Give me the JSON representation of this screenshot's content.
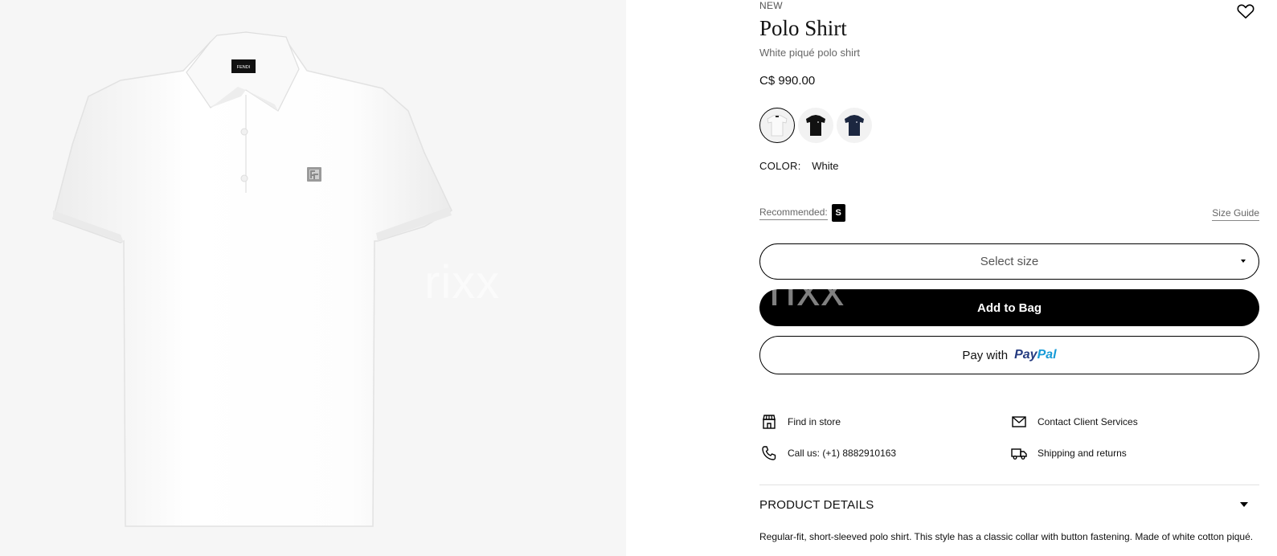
{
  "product": {
    "badge": "NEW",
    "title": "Polo Shirt",
    "subtitle": "White piqué polo shirt",
    "price": "C$ 990.00",
    "color_label": "COLOR:",
    "color_value": "White",
    "swatches": [
      {
        "name": "White",
        "color": "#ffffff",
        "selected": true
      },
      {
        "name": "Black",
        "color": "#111111",
        "selected": false
      },
      {
        "name": "Navy",
        "color": "#1c2740",
        "selected": false
      }
    ],
    "brand_tag": "FENDI"
  },
  "size": {
    "recommended_label": "Recommended:",
    "recommended_value": "S",
    "size_guide": "Size Guide",
    "select_placeholder": "Select size"
  },
  "actions": {
    "add_to_bag": "Add to Bag",
    "pay_with": "Pay with",
    "paypal_pay": "Pay",
    "paypal_pal": "Pal"
  },
  "services": {
    "find_in_store": "Find in store",
    "contact": "Contact Client Services",
    "call": "Call us: (+1) 8882910163",
    "shipping": "Shipping and returns"
  },
  "details": {
    "heading": "PRODUCT DETAILS",
    "description": "Regular-fit, short-sleeved polo shirt. This style has a classic collar with button fastening. Made of white cotton piqué."
  },
  "watermarks": [
    "rixx",
    "rixx"
  ]
}
